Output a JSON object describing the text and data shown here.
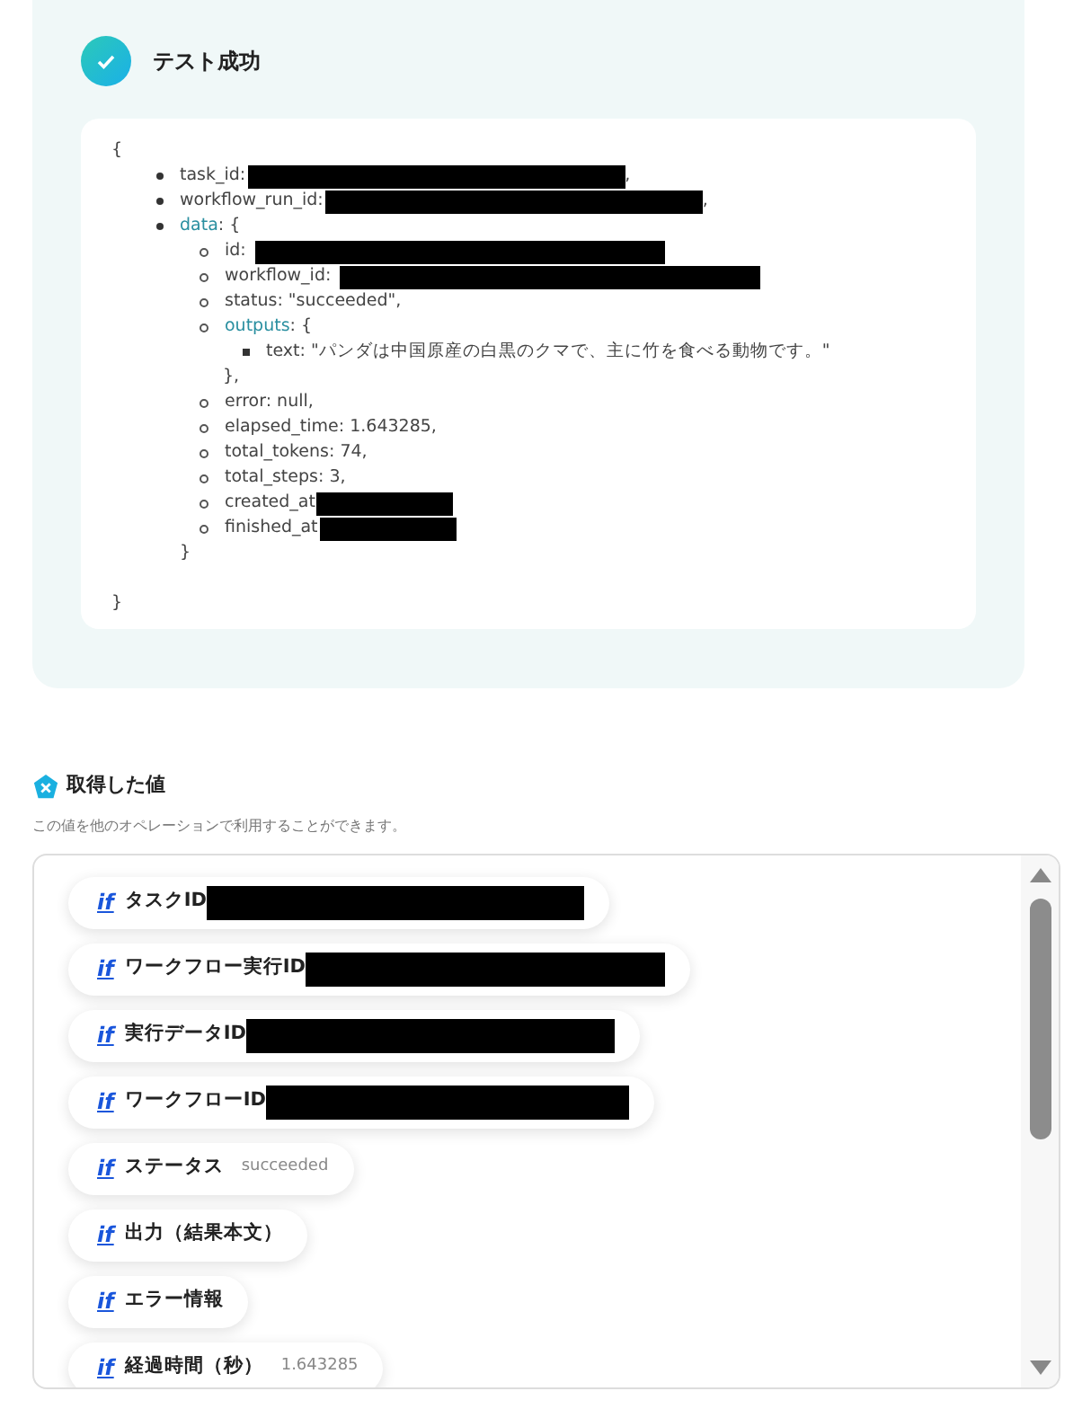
{
  "test_result": {
    "title": "テスト成功",
    "json_view": {
      "open": "{",
      "close": "}",
      "items": [
        {
          "key": "task_id:",
          "redacted": true,
          "after": ","
        },
        {
          "key": "workflow_run_id:",
          "redacted": true,
          "after": ","
        },
        {
          "key": "data",
          "linked": true,
          "rest": ": {",
          "close": "}",
          "children": [
            {
              "key": "id:",
              "redacted": true
            },
            {
              "key": "workflow_id:",
              "redacted": true
            },
            {
              "key": "status: \"succeeded\","
            },
            {
              "key": "outputs",
              "linked": true,
              "rest": ": {",
              "close": "},",
              "children": [
                {
                  "key": "text: \"パンダは中国原産の白黒のクマで、主に竹を食べる動物です。\""
                }
              ]
            },
            {
              "key": "error: null,"
            },
            {
              "key": "elapsed_time: 1.643285,"
            },
            {
              "key": "total_tokens: 74,"
            },
            {
              "key": "total_steps: 3,"
            },
            {
              "key": "created_at",
              "redacted": true
            },
            {
              "key": "finished_at",
              "redacted": true
            }
          ]
        }
      ]
    }
  },
  "results": {
    "title": "取得した値",
    "subtitle": "この値を他のオペレーションで利用することができます。",
    "items": [
      {
        "icon": "if",
        "label": "タスクID",
        "redacted": true
      },
      {
        "icon": "if",
        "label": "ワークフロー実行ID",
        "redacted": true
      },
      {
        "icon": "if",
        "label": "実行データID",
        "redacted": true
      },
      {
        "icon": "if",
        "label": "ワークフローID",
        "redacted": true
      },
      {
        "icon": "if",
        "label": "ステータス",
        "value": "succeeded"
      },
      {
        "icon": "if",
        "label": "出力（結果本文）"
      },
      {
        "icon": "if",
        "label": "エラー情報"
      },
      {
        "icon": "if",
        "label": "経過時間（秒）",
        "value": "1.643285"
      }
    ]
  }
}
